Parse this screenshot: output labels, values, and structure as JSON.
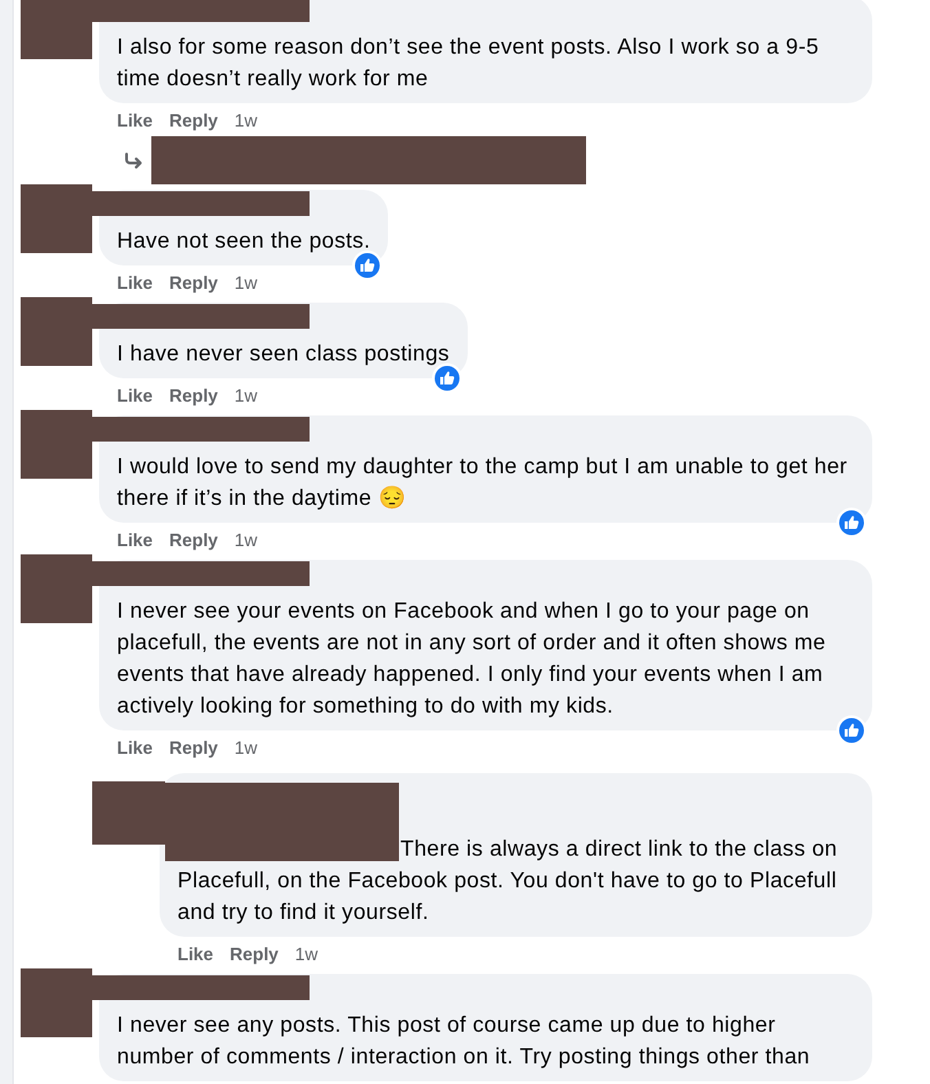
{
  "comments": [
    {
      "text": "I also for some reason don’t see the event posts. Also I work so a 9-5 time doesn’t really work for me",
      "like": "Like",
      "reply": "Reply",
      "time": "1w",
      "reacted": false,
      "reply_link": true
    },
    {
      "text": "Have not seen the posts.",
      "like": "Like",
      "reply": "Reply",
      "time": "1w",
      "reacted": true
    },
    {
      "text": "I have never seen class postings",
      "like": "Like",
      "reply": "Reply",
      "time": "1w",
      "reacted": true
    },
    {
      "text": "I would love to send my daughter to the camp but I am unable to get her there if it’s in the daytime 😔",
      "like": "Like",
      "reply": "Reply",
      "time": "1w",
      "reacted": true
    },
    {
      "text": "I never see your events on Facebook and when I go to your page on placefull, the events are not in any sort of order and it often shows me events that have already happened. I only find your events when I am actively looking for something to do with my kids.",
      "like": "Like",
      "reply": "Reply",
      "time": "1w",
      "reacted": true,
      "children": [
        {
          "text": "There is always a direct link to the class on Placefull, on the Facebook post. You don't have to go to Placefull and try to find it yourself.",
          "like": "Like",
          "reply": "Reply",
          "time": "1w",
          "reacted": false
        }
      ]
    },
    {
      "text": "I never see any posts. This post of course came up due to higher number of comments / interaction on it. Try posting things other than",
      "reacted": false
    }
  ]
}
